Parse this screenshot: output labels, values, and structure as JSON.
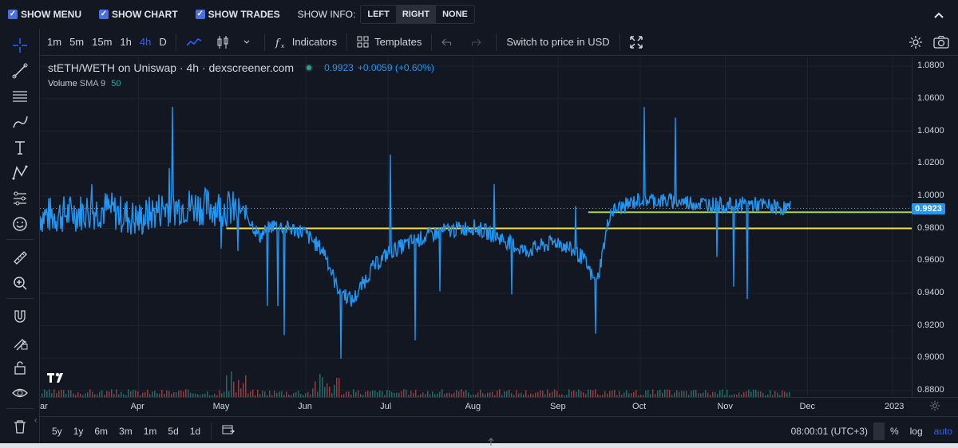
{
  "topbar": {
    "show_menu": "SHOW MENU",
    "show_chart": "SHOW CHART",
    "show_trades": "SHOW TRADES",
    "show_info": "SHOW INFO:",
    "info_options": [
      "LEFT",
      "RIGHT",
      "NONE"
    ],
    "info_selected": "RIGHT"
  },
  "header": {
    "timeframes": [
      "1m",
      "5m",
      "15m",
      "1h",
      "4h",
      "D"
    ],
    "active_timeframe": "4h",
    "indicators": "Indicators",
    "templates": "Templates",
    "switch_price": "Switch to price in USD"
  },
  "legend": {
    "symbol": "stETH/WETH on Uniswap · 4h · dexscreener.com",
    "price": "0.9923",
    "change": "+0.0059 (+0.60%)",
    "volume_label": "Volume",
    "sma_label": "SMA 9",
    "sma_value": "50"
  },
  "yaxis": {
    "labels": [
      "1.0800",
      "1.0600",
      "1.0400",
      "1.0200",
      "1.0000",
      "0.9800",
      "0.9600",
      "0.9400",
      "0.9200",
      "0.9000",
      "0.8800"
    ],
    "current_price": "0.9923"
  },
  "xaxis": {
    "labels": [
      "ar",
      "Apr",
      "May",
      "Jun",
      "Jul",
      "Aug",
      "Sep",
      "Oct",
      "Nov",
      "Dec",
      "2023"
    ]
  },
  "bottom": {
    "ranges": [
      "5y",
      "1y",
      "6m",
      "3m",
      "1m",
      "5d",
      "1d"
    ],
    "time": "08:00:01 (UTC+3)",
    "percent": "%",
    "log": "log",
    "auto": "auto"
  },
  "colors": {
    "price_line": "#2196f3",
    "support_yellow": "#f5e142",
    "support_green": "#a8d640",
    "volume_up": "#26a69a",
    "volume_down": "#ef5350"
  },
  "chart_data": {
    "type": "line",
    "series": [
      {
        "x": [
          "2022-03-01",
          "2022-03-10",
          "2022-03-20",
          "2022-04-01",
          "2022-04-10",
          "2022-04-20",
          "2022-05-01",
          "2022-05-10",
          "2022-05-15",
          "2022-05-20",
          "2022-05-31",
          "2022-06-08",
          "2022-06-12",
          "2022-06-18",
          "2022-06-25",
          "2022-07-01",
          "2022-07-10",
          "2022-07-20",
          "2022-08-01",
          "2022-08-10",
          "2022-08-20",
          "2022-09-01",
          "2022-09-10",
          "2022-09-15",
          "2022-09-20",
          "2022-10-01",
          "2022-10-10",
          "2022-10-20",
          "2022-11-01",
          "2022-11-10",
          "2022-11-20",
          "2022-11-25"
        ],
        "y": [
          0.988,
          0.99,
          0.992,
          0.985,
          0.993,
          0.994,
          0.993,
          0.99,
          0.975,
          0.982,
          0.978,
          0.965,
          0.945,
          0.935,
          0.955,
          0.965,
          0.972,
          0.978,
          0.981,
          0.975,
          0.966,
          0.972,
          0.962,
          0.945,
          0.99,
          0.998,
          0.997,
          0.996,
          0.994,
          0.995,
          0.993,
          0.9923
        ]
      }
    ],
    "horizontal_lines": [
      0.98,
      0.99
    ],
    "ylim": [
      0.876,
      1.086
    ],
    "grid": true
  }
}
